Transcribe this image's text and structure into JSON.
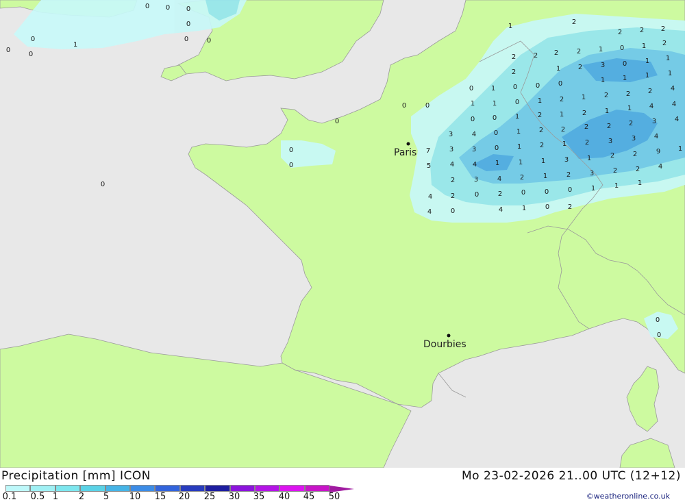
{
  "map": {
    "cities": [
      {
        "name": "Paris"
      },
      {
        "name": "Dourbies"
      }
    ],
    "precip_values": [
      "0",
      "0",
      "0",
      "1",
      "0",
      "0",
      "0",
      "0",
      "0",
      "0",
      "0",
      "0",
      "0",
      "0",
      "0",
      "0",
      "1",
      "2",
      "2",
      "2",
      "2",
      "2",
      "2",
      "1",
      "0",
      "1",
      "2",
      "2",
      "2",
      "1",
      "2",
      "3",
      "0",
      "1",
      "1",
      "2",
      "1",
      "1",
      "1",
      "1",
      "0",
      "1",
      "0",
      "0",
      "0",
      "1",
      "1",
      "0",
      "1",
      "2",
      "1",
      "2",
      "2",
      "2",
      "4",
      "0",
      "0",
      "1",
      "2",
      "1",
      "2",
      "1",
      "1",
      "4",
      "4",
      "3",
      "4",
      "0",
      "1",
      "2",
      "2",
      "2",
      "2",
      "2",
      "3",
      "4",
      "7",
      "3",
      "3",
      "0",
      "1",
      "2",
      "1",
      "2",
      "3",
      "3",
      "4",
      "5",
      "4",
      "4",
      "1",
      "1",
      "1",
      "3",
      "1",
      "2",
      "2",
      "9",
      "1",
      "2",
      "3",
      "4",
      "2",
      "1",
      "2",
      "3",
      "2",
      "2",
      "4",
      "1",
      "4",
      "2",
      "0",
      "2",
      "0",
      "0",
      "0",
      "1",
      "1",
      "1",
      "4",
      "0",
      "4",
      "1",
      "0",
      "2",
      "0",
      "0",
      "2",
      "1",
      "0",
      "2",
      "1",
      "0",
      "0",
      "1",
      "1",
      "0",
      "0",
      "0",
      "0",
      "0",
      "0"
    ]
  },
  "footer": {
    "title": "Precipitation [mm] ICON",
    "datetime": "Mo 23-02-2026 21..00 UTC (12+12)",
    "credit": "©weatheronline.co.uk"
  },
  "legend": {
    "labels": [
      "0.1",
      "0.5",
      "1",
      "2",
      "5",
      "10",
      "15",
      "20",
      "25",
      "30",
      "35",
      "40",
      "45",
      "50"
    ],
    "colors": [
      "#bef8fa",
      "#a0f0f4",
      "#7de6ee",
      "#5ad2e6",
      "#46b4e6",
      "#3c8ce6",
      "#3264dc",
      "#283cbe",
      "#1e1ea0",
      "#8c14dc",
      "#b414e6",
      "#dc14f0",
      "#c814c8",
      "#a01aa0"
    ]
  },
  "colors": {
    "sea": "#e8e8e8",
    "land": "#cdfaa0",
    "precip_light": "#c8f8f8",
    "precip_mid": "#96e6f0",
    "precip_heavy": "#6ec8ec",
    "precip_max": "#4aa8e6",
    "border": "#9a9a9a"
  }
}
